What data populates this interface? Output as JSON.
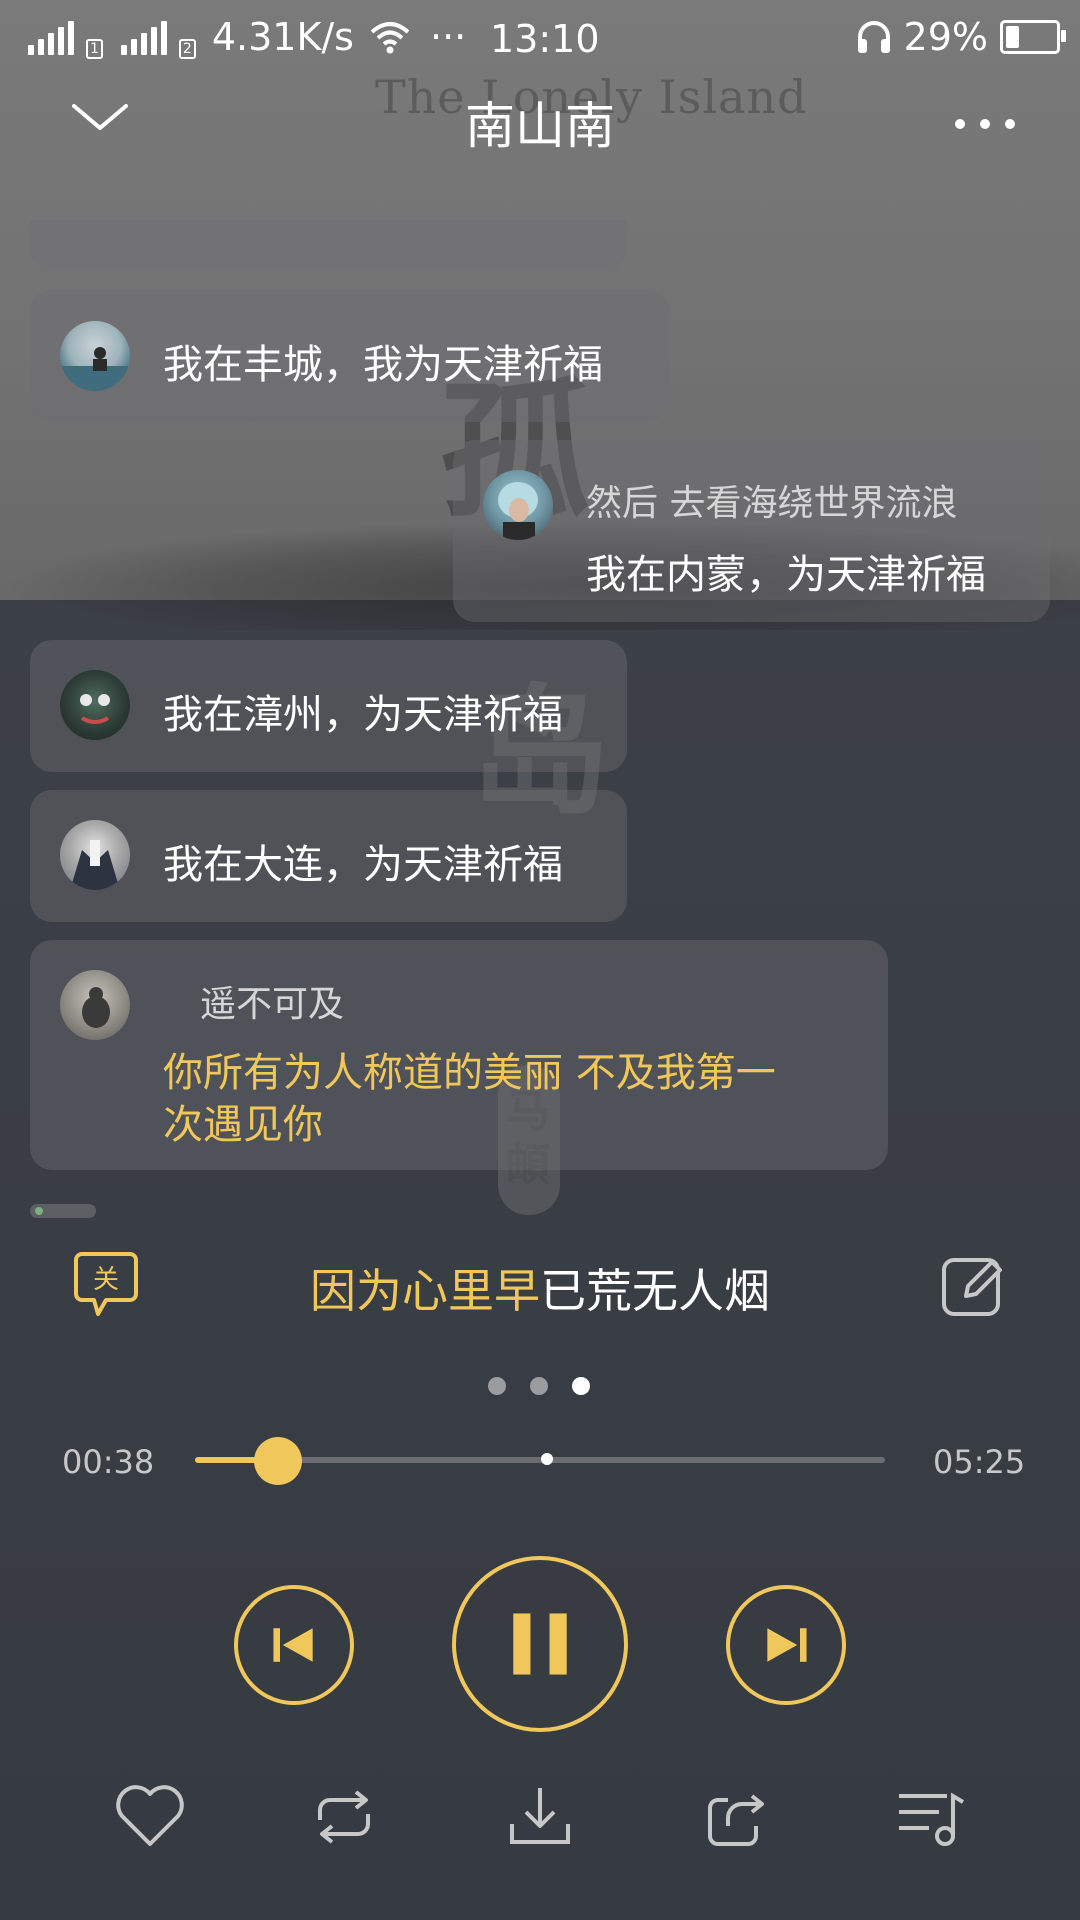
{
  "status_bar": {
    "sim1": "1",
    "sim2": "2",
    "net_speed": "4.31K/s",
    "more_dots": "···",
    "time": "13:10",
    "battery_text": "29%",
    "battery_level": 0.29
  },
  "header": {
    "title": "南山南",
    "icons": [
      "chevron-down-icon",
      "more-icon"
    ]
  },
  "background_art": {
    "english_title": "The Lonely Island",
    "calligraphy": [
      "孤",
      "岛",
      "马頔"
    ]
  },
  "comments": [
    {
      "text": "我在丰城，我为天津祈福"
    },
    {
      "name": "然后 去看海绕世界流浪",
      "text": "我在内蒙，为天津祈福"
    },
    {
      "text": "我在漳州，为天津祈福"
    },
    {
      "text": "我在大连，为天津祈福"
    },
    {
      "name": "遥不可及",
      "text_line1": "你所有为人称道的美丽 不及我第一",
      "text_line2": "次遇见你"
    }
  ],
  "lyric": {
    "tag_label": "关",
    "sung": "因为心里早",
    "unsung": "已荒无人烟"
  },
  "pager": {
    "count": 3,
    "active_index": 2
  },
  "progress": {
    "current": "00:38",
    "total": "05:25",
    "played_fraction": 0.121,
    "buffered_fraction": 0.51
  },
  "controls": [
    "previous-icon",
    "pause-icon",
    "next-icon"
  ],
  "bottom_actions": [
    "heart-icon",
    "repeat-icon",
    "download-icon",
    "share-icon",
    "playlist-icon"
  ],
  "colors": {
    "accent": "#f0c75a",
    "text": "#ffffff",
    "muted": "#c7c7c7"
  }
}
